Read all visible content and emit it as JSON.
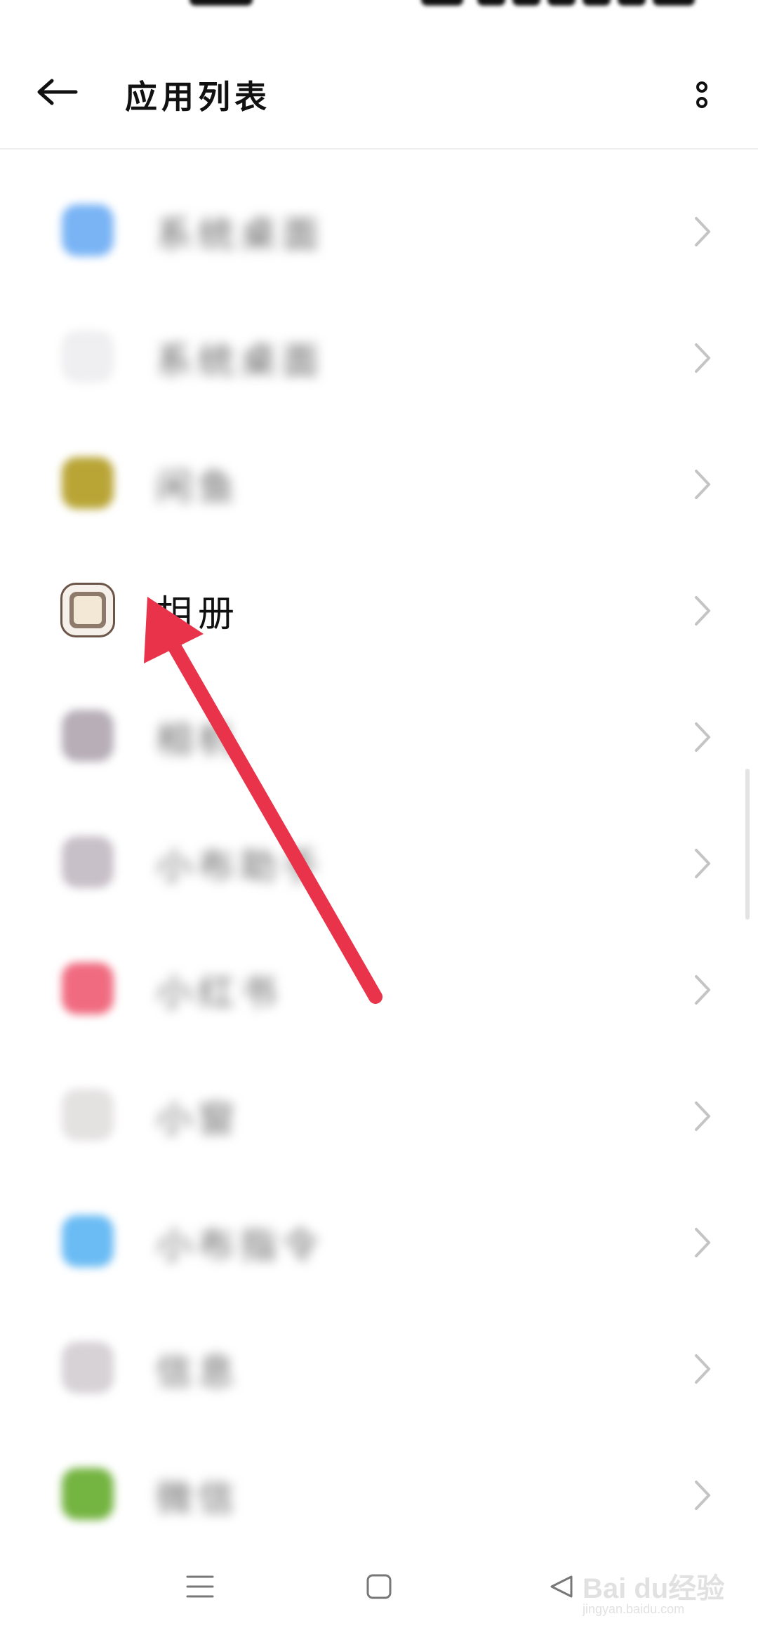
{
  "header": {
    "title": "应用列表",
    "back_icon": "arrow-left-icon",
    "more_icon": "more-vertical-icon"
  },
  "apps": [
    {
      "label": "系统桌面",
      "icon_color": "#7ab4f5",
      "blurred": true
    },
    {
      "label": "系统桌面",
      "icon_color": "#efeef0",
      "blurred": true
    },
    {
      "label": "闲鱼",
      "icon_color": "#b9a536",
      "blurred": true
    },
    {
      "label": "相册",
      "icon_color": "#f6f0ea",
      "blurred": false
    },
    {
      "label": "相机",
      "icon_color": "#b7aeb8",
      "blurred": true
    },
    {
      "label": "小布助手",
      "icon_color": "#c8c0c8",
      "blurred": true
    },
    {
      "label": "小红书",
      "icon_color": "#f06b80",
      "blurred": true
    },
    {
      "label": "小窗",
      "icon_color": "#e4e1e1",
      "blurred": true
    },
    {
      "label": "小布指令",
      "icon_color": "#6bbcf4",
      "blurred": true
    },
    {
      "label": "信息",
      "icon_color": "#d6d2d6",
      "blurred": true
    },
    {
      "label": "微信",
      "icon_color": "#74b441",
      "blurred": true
    }
  ],
  "annotation": {
    "color": "#e8334a"
  },
  "navbar": {
    "menu_icon": "menu-icon",
    "home_icon": "home-square-icon",
    "back_icon": "triangle-back-icon"
  },
  "watermark": {
    "text": "Bai du经验",
    "sub": "jingyan.baidu.com"
  }
}
